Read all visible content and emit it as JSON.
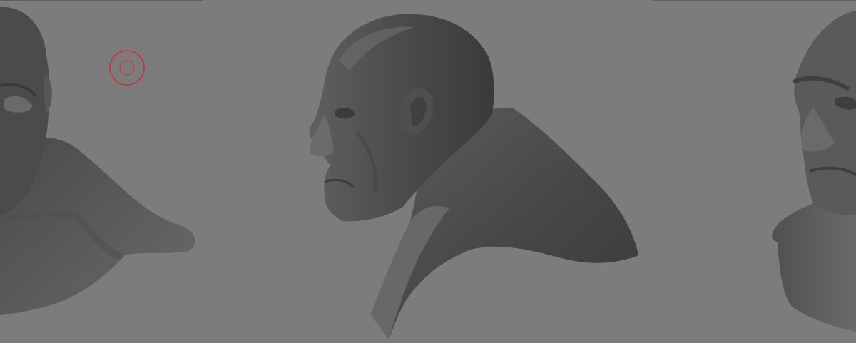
{
  "viewport": {
    "background": "#7c7c7c",
    "content": [
      "sculpt-bust-left-view",
      "sculpt-bust-center-profile",
      "sculpt-bust-right-view"
    ]
  },
  "brush_cursor": {
    "icon": "circle-brush-cursor-icon",
    "color": "#d62b2b"
  },
  "colors": {
    "mesh_dark": "#3f3f3f",
    "mesh_mid": "#555555",
    "mesh_light": "#6e6e6e"
  }
}
